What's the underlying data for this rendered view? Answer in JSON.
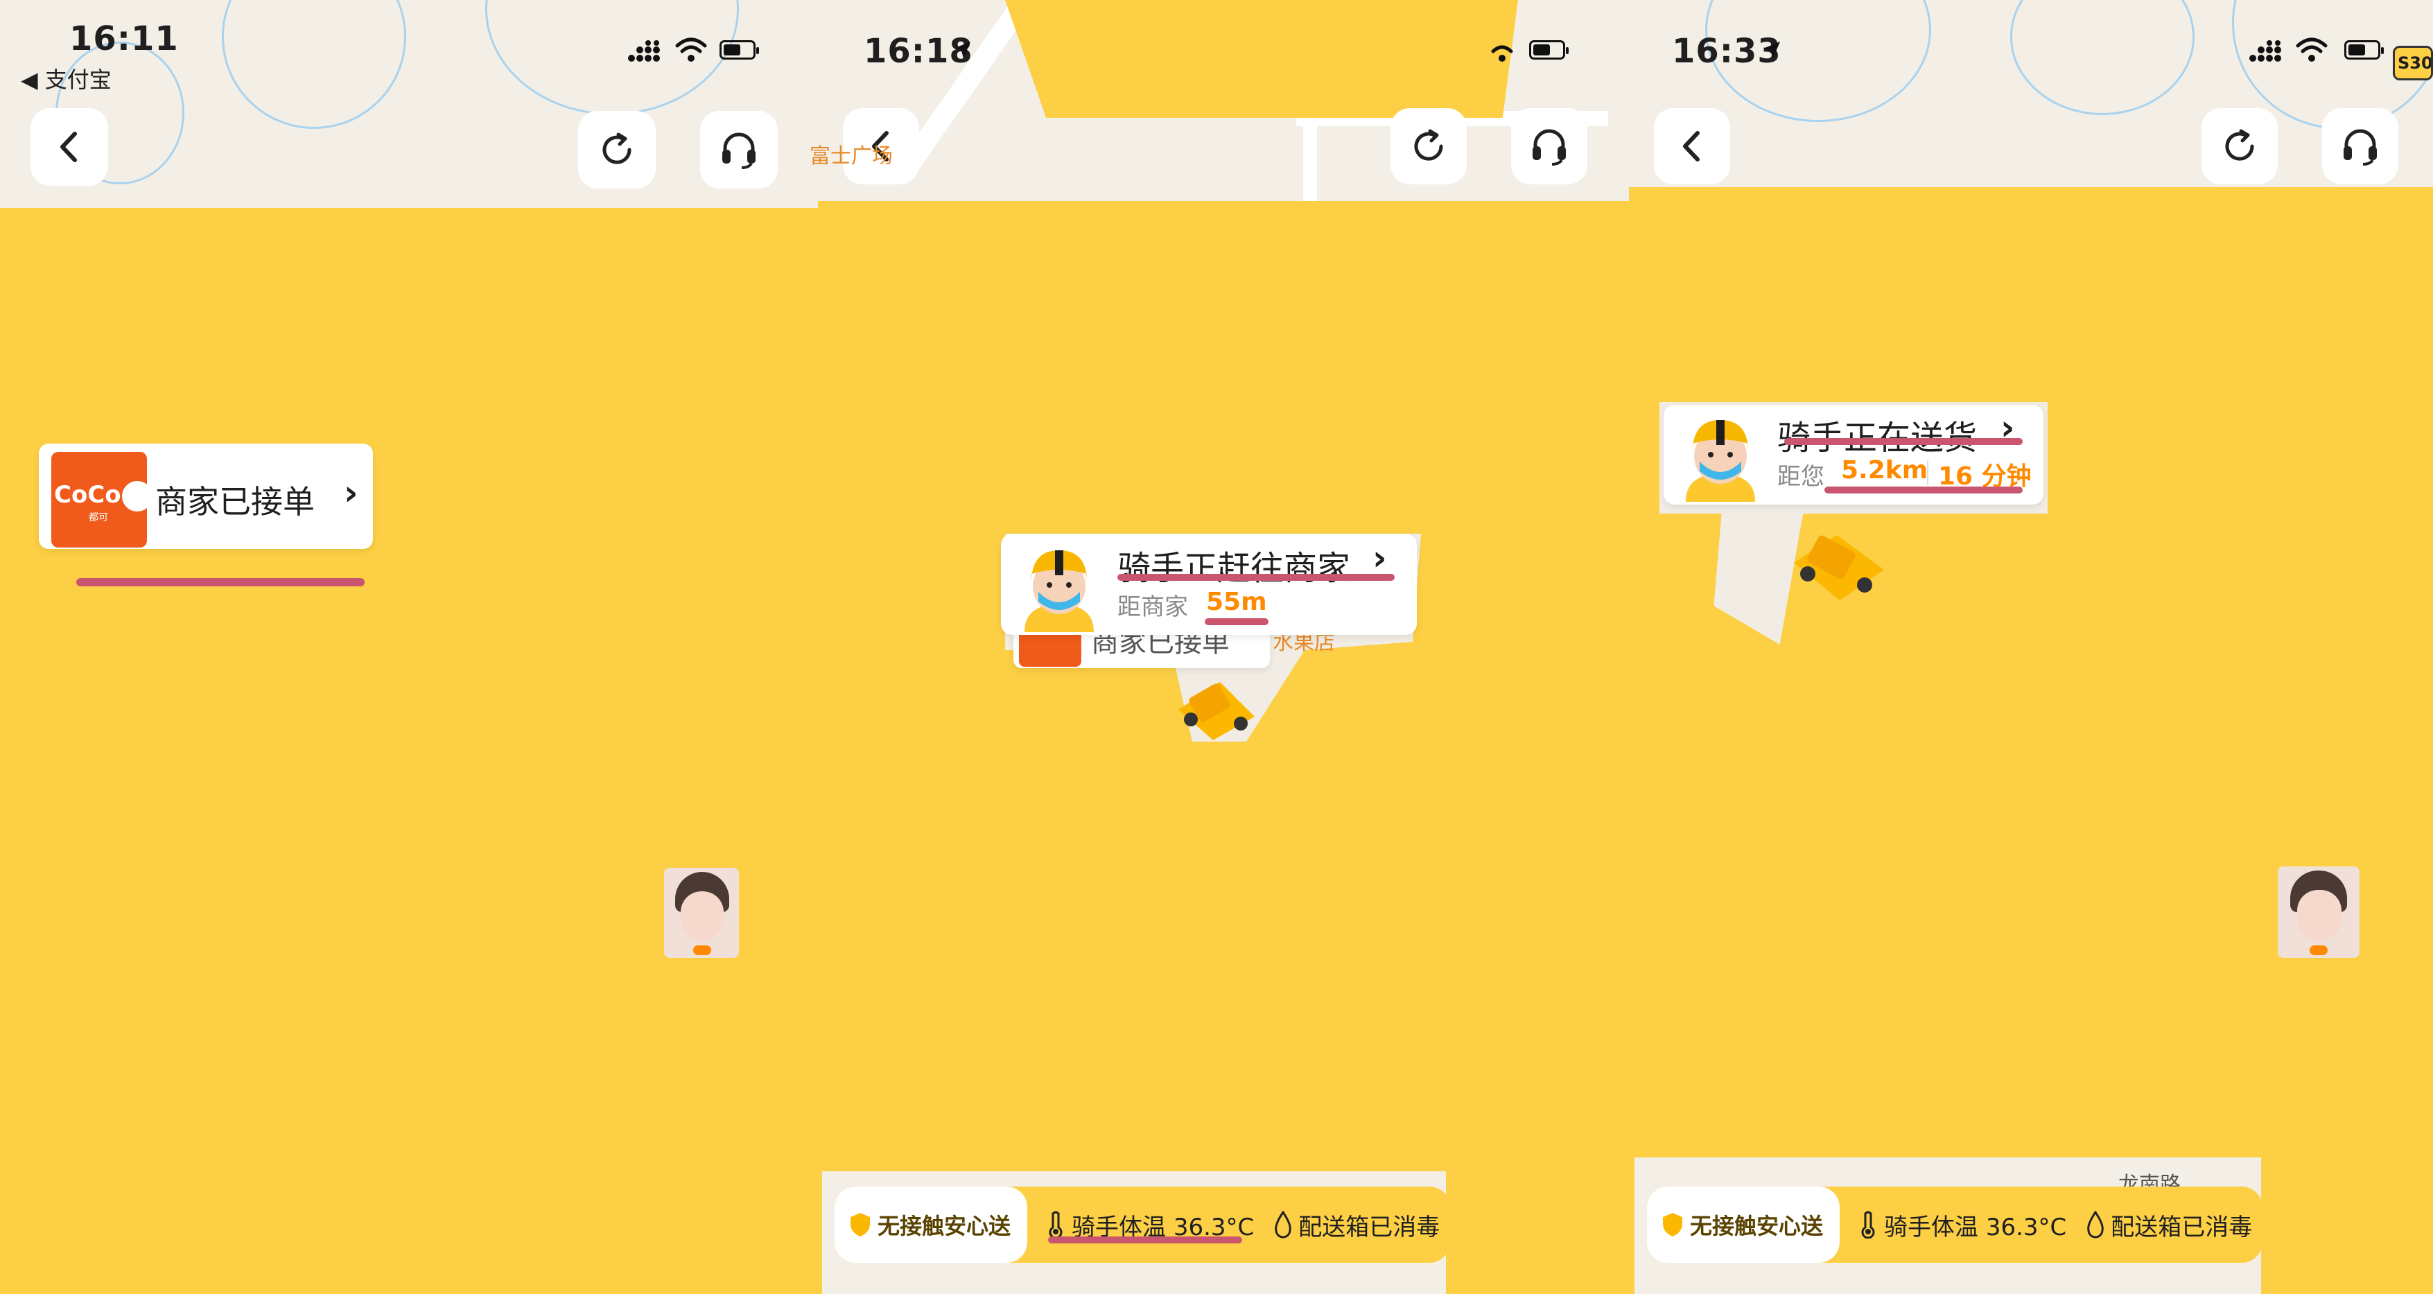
{
  "panels": [
    {
      "status": {
        "time": "16:11",
        "back_app": "◀ 支付宝"
      },
      "order_status": {
        "label": "商家已接单",
        "chevron": "›"
      },
      "merchant_logo": {
        "text": "CoCo",
        "sub": "都可"
      }
    },
    {
      "status": {
        "time": "16:18"
      },
      "map_label": "富士广场",
      "rider_card": {
        "title": "骑手正赶往商家",
        "chevron": "›",
        "distance_label": "距商家",
        "distance_value": "55m"
      },
      "merchant_label_behind": "商家已接单",
      "merchant_tail": "水果店",
      "safety_bar": {
        "badge": "无接触安心送",
        "temp": "骑手体温 36.3°C",
        "box": "配送箱已消毒"
      }
    },
    {
      "status": {
        "time": "16:33",
        "route_badge": "S30"
      },
      "rider_card": {
        "title": "骑手正在送货",
        "chevron": "›",
        "distance_label": "距您",
        "distance_value": "5.2km",
        "eta": "16 分钟"
      },
      "map_label": "龙南路",
      "safety_bar": {
        "badge": "无接触安心送",
        "temp": "骑手体温 36.3°C",
        "box": "配送箱已消毒"
      }
    }
  ],
  "colors": {
    "accent": "#fccf45",
    "orange": "#ff8a00",
    "marker": "#c9566e",
    "coco": "#f05a1a"
  }
}
